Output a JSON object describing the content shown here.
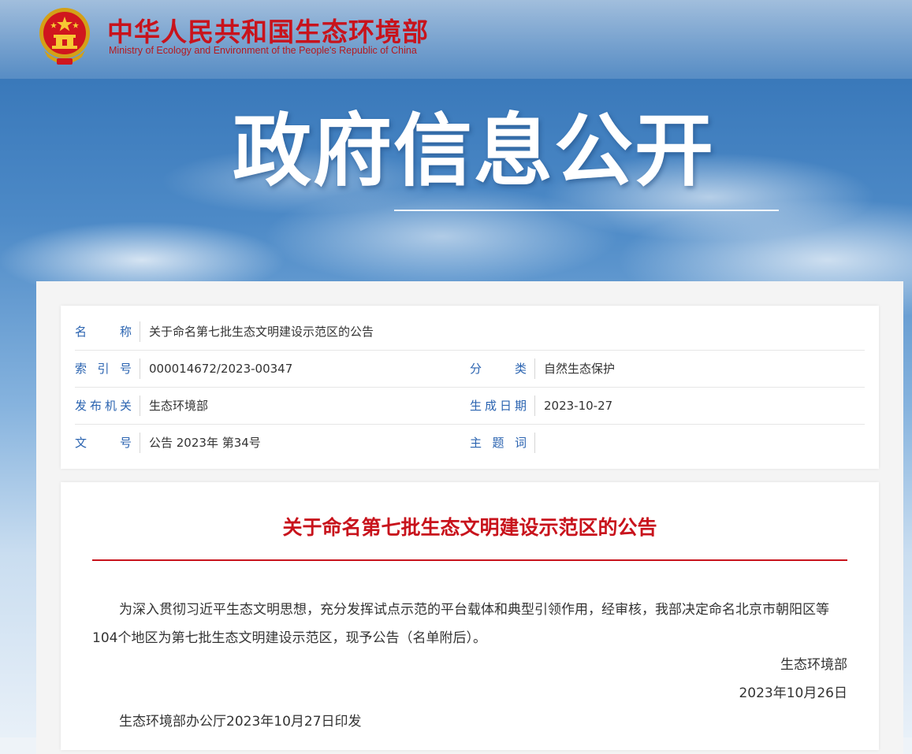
{
  "header": {
    "ministry_cn": "中华人民共和国生态环境部",
    "ministry_en": "Ministry of Ecology and Environment of the People's Republic of China",
    "emblem_icon": "national-emblem-icon",
    "banner_title": "政府信息公开"
  },
  "meta": {
    "name_label": "名　　称",
    "name_value": "关于命名第七批生态文明建设示范区的公告",
    "index_label": "索 引 号",
    "index_value": "000014672/2023-00347",
    "category_label": "分　　类",
    "category_value": "自然生态保护",
    "issuer_label": "发布机关",
    "issuer_value": "生态环境部",
    "date_label": "生成日期",
    "date_value": "2023-10-27",
    "docno_label": "文　　号",
    "docno_value": "公告 2023年 第34号",
    "keyword_label": "主 题 词",
    "keyword_value": ""
  },
  "article": {
    "title": "关于命名第七批生态文明建设示范区的公告",
    "body": "为深入贯彻习近平生态文明思想，充分发挥试点示范的平台载体和典型引领作用，经审核，我部决定命名北京市朝阳区等104个地区为第七批生态文明建设示范区，现予公告（名单附后）。",
    "sign_org": "生态环境部",
    "sign_date": "2023年10月26日",
    "print_line": "生态环境部办公厅2023年10月27日印发"
  },
  "colors": {
    "brand_red": "#c8131c",
    "label_blue": "#2a63b0"
  }
}
